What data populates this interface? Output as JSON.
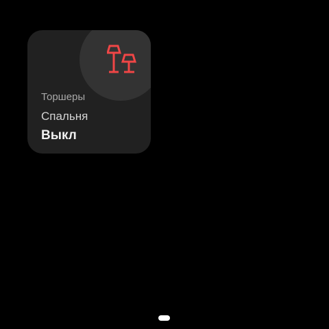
{
  "tile": {
    "category": "Торшеры",
    "room": "Спальня",
    "state": "Выкл",
    "icon": "floor-lamps-icon",
    "accent": "#f04646"
  }
}
